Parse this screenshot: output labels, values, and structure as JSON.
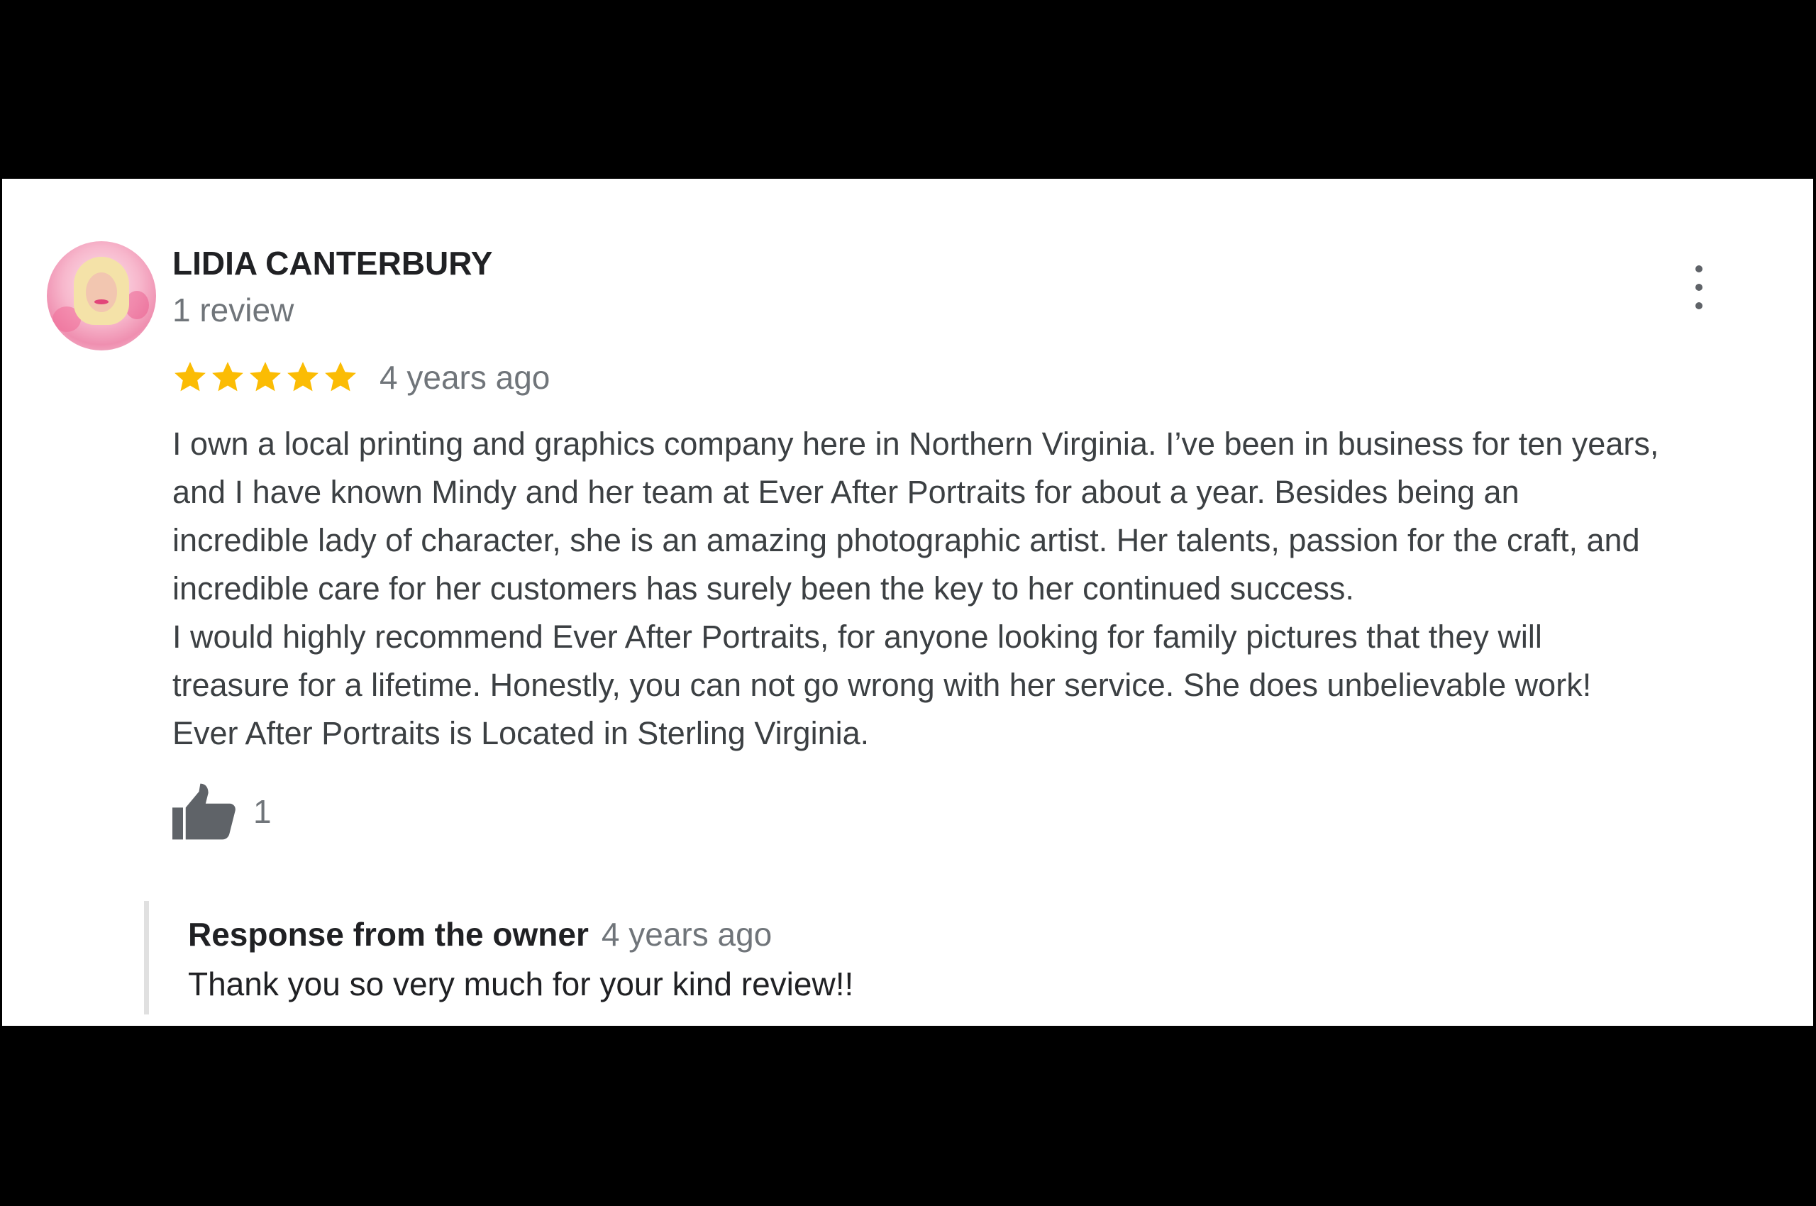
{
  "review": {
    "reviewer_name": "LIDIA CANTERBURY",
    "review_count": "1 review",
    "rating": 5,
    "rating_max": 5,
    "date": "4 years ago",
    "text": "I own a local printing and graphics company here in Northern Virginia. I’ve been in business for ten years,\nand I have known Mindy and her team at Ever After Portraits for about a year. Besides being an\nincredible lady of character, she is an amazing photographic artist. Her talents, passion for the craft, and\nincredible care for her customers has surely been the key to her continued success.\nI would highly recommend Ever After Portraits, for anyone looking for family pictures that they will\ntreasure for a lifetime. Honestly, you can not go wrong with her service. She does unbelievable work!\nEver After Portraits is Located in Sterling Virginia.",
    "like_count": "1"
  },
  "owner_response": {
    "title": "Response from the owner",
    "date": "4 years ago",
    "text": "Thank you so very much for your kind review!!"
  },
  "icons": {
    "star": "star-icon",
    "like": "thumbs-up-icon",
    "more": "more-vertical-icon"
  },
  "colors": {
    "star": "#fbbc04",
    "primary_text": "#202124",
    "secondary_text": "#70757a",
    "icon_gray": "#5f6368",
    "response_bar": "#e0e0e0"
  }
}
